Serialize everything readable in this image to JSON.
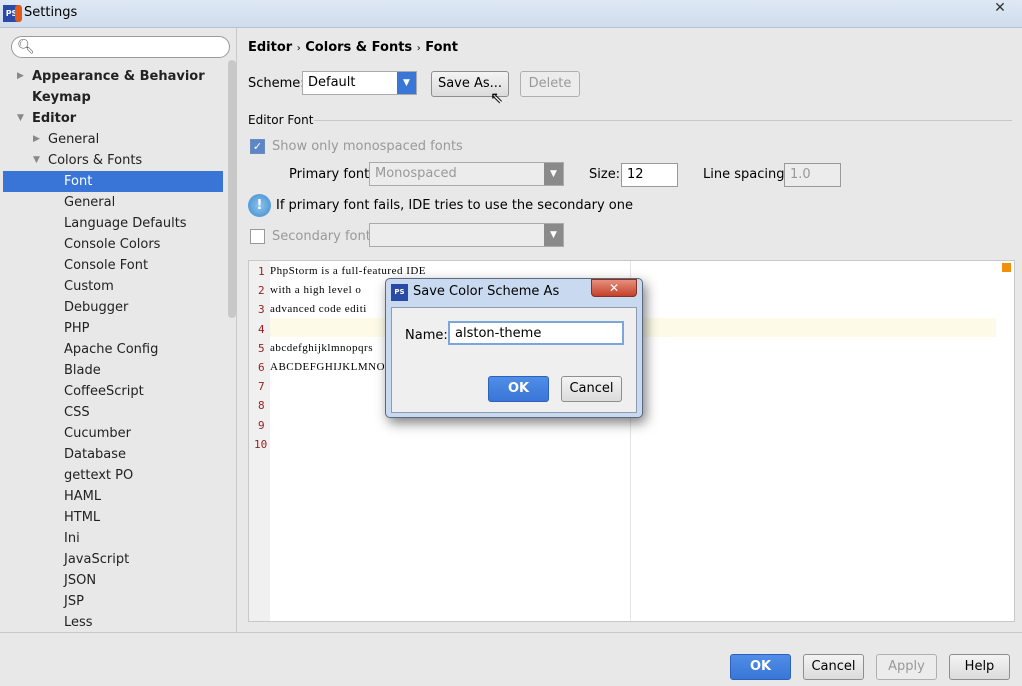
{
  "window": {
    "title": "Settings",
    "close": "✕"
  },
  "sidebar": {
    "search_placeholder": "",
    "items": [
      {
        "label": "Appearance & Behavior",
        "level": 0,
        "arrow": "▶",
        "bold": true
      },
      {
        "label": "Keymap",
        "level": 0,
        "arrow": "",
        "bold": true
      },
      {
        "label": "Editor",
        "level": 0,
        "arrow": "▼",
        "bold": true
      },
      {
        "label": "General",
        "level": 1,
        "arrow": "▶"
      },
      {
        "label": "Colors & Fonts",
        "level": 1,
        "arrow": "▼"
      },
      {
        "label": "Font",
        "level": 2,
        "selected": true
      },
      {
        "label": "General",
        "level": 2
      },
      {
        "label": "Language Defaults",
        "level": 2
      },
      {
        "label": "Console Colors",
        "level": 2
      },
      {
        "label": "Console Font",
        "level": 2
      },
      {
        "label": "Custom",
        "level": 2
      },
      {
        "label": "Debugger",
        "level": 2
      },
      {
        "label": "PHP",
        "level": 2
      },
      {
        "label": "Apache Config",
        "level": 2
      },
      {
        "label": "Blade",
        "level": 2
      },
      {
        "label": "CoffeeScript",
        "level": 2
      },
      {
        "label": "CSS",
        "level": 2
      },
      {
        "label": "Cucumber",
        "level": 2
      },
      {
        "label": "Database",
        "level": 2
      },
      {
        "label": "gettext PO",
        "level": 2
      },
      {
        "label": "HAML",
        "level": 2
      },
      {
        "label": "HTML",
        "level": 2
      },
      {
        "label": "Ini",
        "level": 2
      },
      {
        "label": "JavaScript",
        "level": 2
      },
      {
        "label": "JSON",
        "level": 2
      },
      {
        "label": "JSP",
        "level": 2
      },
      {
        "label": "Less",
        "level": 2
      }
    ]
  },
  "breadcrumb": {
    "a": "Editor",
    "b": "Colors & Fonts",
    "c": "Font",
    "sep": "›"
  },
  "scheme": {
    "label": "Scheme:",
    "value": "Default",
    "save_as": "Save As...",
    "delete": "Delete"
  },
  "editor_font": {
    "section": "Editor Font",
    "mono_only": "Show only monospaced fonts",
    "mono_checked": true,
    "primary_label": "Primary font:",
    "primary_value": "Monospaced",
    "size_label": "Size:",
    "size_value": "12",
    "spacing_label": "Line spacing:",
    "spacing_value": "1.0",
    "info": "If primary font fails, IDE tries to use the secondary one",
    "secondary_label": "Secondary font:",
    "secondary_checked": false,
    "secondary_value": ""
  },
  "preview": {
    "lines": [
      "PhpStorm is a full-featured IDE",
      "with a high level o",
      "advanced code editi",
      "",
      "abcdefghijklmnopqrs",
      "ABCDEFGHIJKLMNOPQRS",
      "",
      "",
      "",
      ""
    ],
    "numbers": [
      "1",
      "2",
      "3",
      "4",
      "5",
      "6",
      "7",
      "8",
      "9",
      "10"
    ]
  },
  "dialog": {
    "title": "Save Color Scheme As",
    "name_label": "Name:",
    "name_value": "alston-theme",
    "ok": "OK",
    "cancel": "Cancel",
    "close": "✕"
  },
  "footer": {
    "ok": "OK",
    "cancel": "Cancel",
    "apply": "Apply",
    "help": "Help"
  },
  "colors": {
    "accent": "#3875d7",
    "marker": "#f0900a"
  }
}
